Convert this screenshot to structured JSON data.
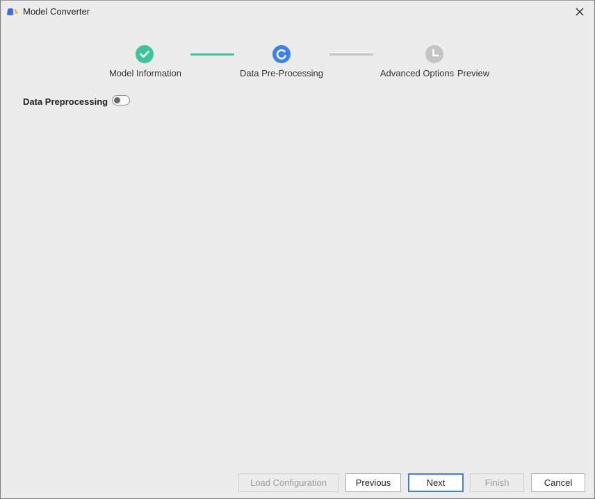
{
  "window": {
    "title": "Model Converter",
    "app_icon": "model-converter-app-icon",
    "close_icon": "close-icon"
  },
  "stepper": {
    "steps": [
      {
        "label": "Model Information",
        "status": "completed",
        "icon": "check-icon",
        "color": "#3cc49a"
      },
      {
        "label": "Data Pre-Processing",
        "status": "in-progress",
        "icon": "spinner-icon",
        "color": "#3b82f6"
      },
      {
        "label": "Advanced Options",
        "status": "pending",
        "icon": "clock-icon",
        "color": "#c4c4c4"
      },
      {
        "label": "Preview",
        "status": "pending",
        "icon": "",
        "color": ""
      }
    ],
    "connectors": [
      {
        "status": "completed",
        "color": "#3cc49a"
      },
      {
        "status": "pending",
        "color": "#c4c4c4"
      }
    ]
  },
  "content": {
    "data_preprocessing_label": "Data Preprocessing",
    "data_preprocessing_enabled": false
  },
  "footer": {
    "load_configuration": "Load Configuration",
    "previous": "Previous",
    "next": "Next",
    "finish": "Finish",
    "cancel": "Cancel"
  },
  "colors": {
    "background": "#ececec",
    "accent_blue": "#3b82f6",
    "success_green": "#3cc49a",
    "focus_border": "#3c83d6"
  }
}
